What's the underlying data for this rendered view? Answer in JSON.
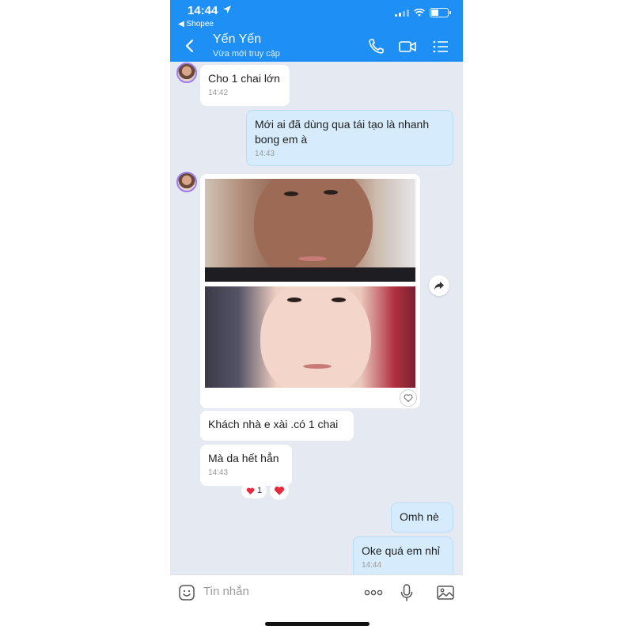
{
  "status_bar": {
    "time": "14:44",
    "back_app": "◀ Shopee"
  },
  "header": {
    "contact_name": "Yến Yến",
    "contact_status": "Vừa mới truy cập"
  },
  "messages": [
    {
      "side": "in",
      "text": "Cho 1 chai lớn",
      "time": "14:42"
    },
    {
      "side": "out",
      "text_line1": "Mới ai đã dùng qua tái tạo là nhanh",
      "text_line2": "bong em à",
      "time": "14:43"
    },
    {
      "side": "in",
      "type": "image"
    },
    {
      "side": "in",
      "text": "Khách nhà e xài .có 1 chai"
    },
    {
      "side": "in",
      "text": "Mà da hết hẳn",
      "time": "14:43"
    },
    {
      "side": "out",
      "text": "Omh nè"
    },
    {
      "side": "out",
      "text": "Oke quá em nhỉ",
      "time": "14:44"
    }
  ],
  "reactions": {
    "count": "1"
  },
  "composer": {
    "placeholder": "Tin nhắn"
  },
  "icons": [
    "location-arrow-icon",
    "signal-icon",
    "wifi-icon",
    "battery-icon",
    "back-icon",
    "phone-icon",
    "video-icon",
    "menu-icon",
    "avatar",
    "share-icon",
    "heart-icon",
    "emoji-icon",
    "more-icon",
    "mic-icon",
    "gallery-icon"
  ],
  "colors": {
    "header": "#1e90f5",
    "chat_bg": "#e5e9f1",
    "outgoing_bubble": "#d6ecfc",
    "incoming_bubble": "#ffffff",
    "reaction": "#e8263c"
  }
}
